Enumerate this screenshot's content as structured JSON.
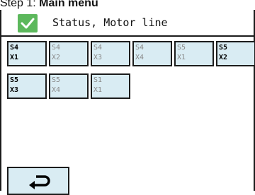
{
  "caption": {
    "prefix": "Step 1: ",
    "bold": "Main menu"
  },
  "header": {
    "title": "Status, Motor line",
    "check_color": "#5cb85c"
  },
  "tiles": [
    {
      "line1": "S4",
      "line2": "X1",
      "state": "active"
    },
    {
      "line1": "S4",
      "line2": "X2",
      "state": "inactive"
    },
    {
      "line1": "S4",
      "line2": "X3",
      "state": "inactive"
    },
    {
      "line1": "S4",
      "line2": "X4",
      "state": "inactive"
    },
    {
      "line1": "S5",
      "line2": "X1",
      "state": "inactive"
    },
    {
      "line1": "S5",
      "line2": "X2",
      "state": "active"
    },
    {
      "line1": "S5",
      "line2": "X3",
      "state": "active"
    },
    {
      "line1": "S5",
      "line2": "X4",
      "state": "inactive"
    },
    {
      "line1": "S1",
      "line2": "X1",
      "state": "inactive"
    }
  ],
  "back_button": {
    "icon": "return-arrow-icon"
  },
  "colors": {
    "tile_background": "#d9ecf3",
    "border": "#1c1c1c",
    "inactive_text": "#8a8a8a"
  }
}
